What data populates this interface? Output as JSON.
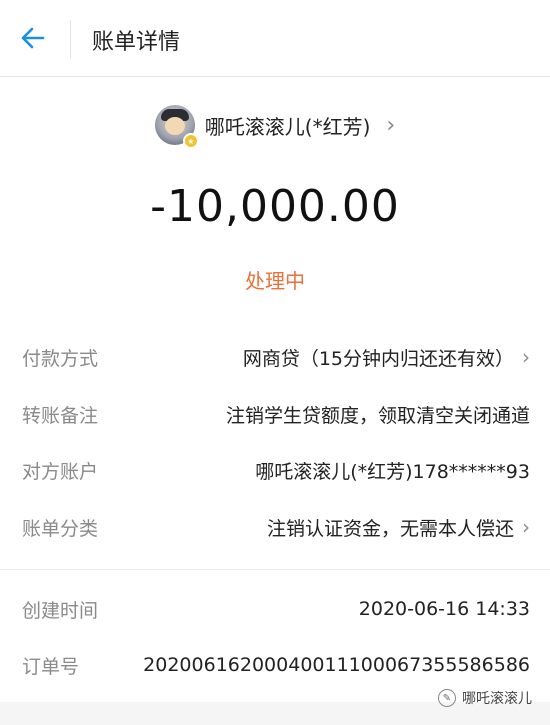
{
  "header": {
    "title": "账单详情",
    "back_icon": "arrow-left-icon",
    "accent_color": "#1a8fe3"
  },
  "payee": {
    "name": "哪吒滚滚儿(*红芳)",
    "chevron": "›"
  },
  "amount": "-10,000.00",
  "status": {
    "text": "处理中",
    "color": "#e8733a"
  },
  "details": [
    {
      "label": "付款方式",
      "value": "网商贷（15分钟内归还还有效）",
      "arrow": "›"
    },
    {
      "label": "转账备注",
      "value": "注销学生贷额度，领取清空关闭通道"
    },
    {
      "label": "对方账户",
      "value": "哪吒滚滚儿(*红芳)178******93"
    },
    {
      "label": "账单分类",
      "value": "注销认证资金，无需本人偿还",
      "arrow": "›"
    }
  ],
  "meta": [
    {
      "label": "创建时间",
      "value": "2020-06-16 14:33"
    },
    {
      "label": "订单号",
      "value": "20200616200040011100067355586586"
    }
  ],
  "watermark": {
    "text": "哪吒滚滚儿"
  }
}
